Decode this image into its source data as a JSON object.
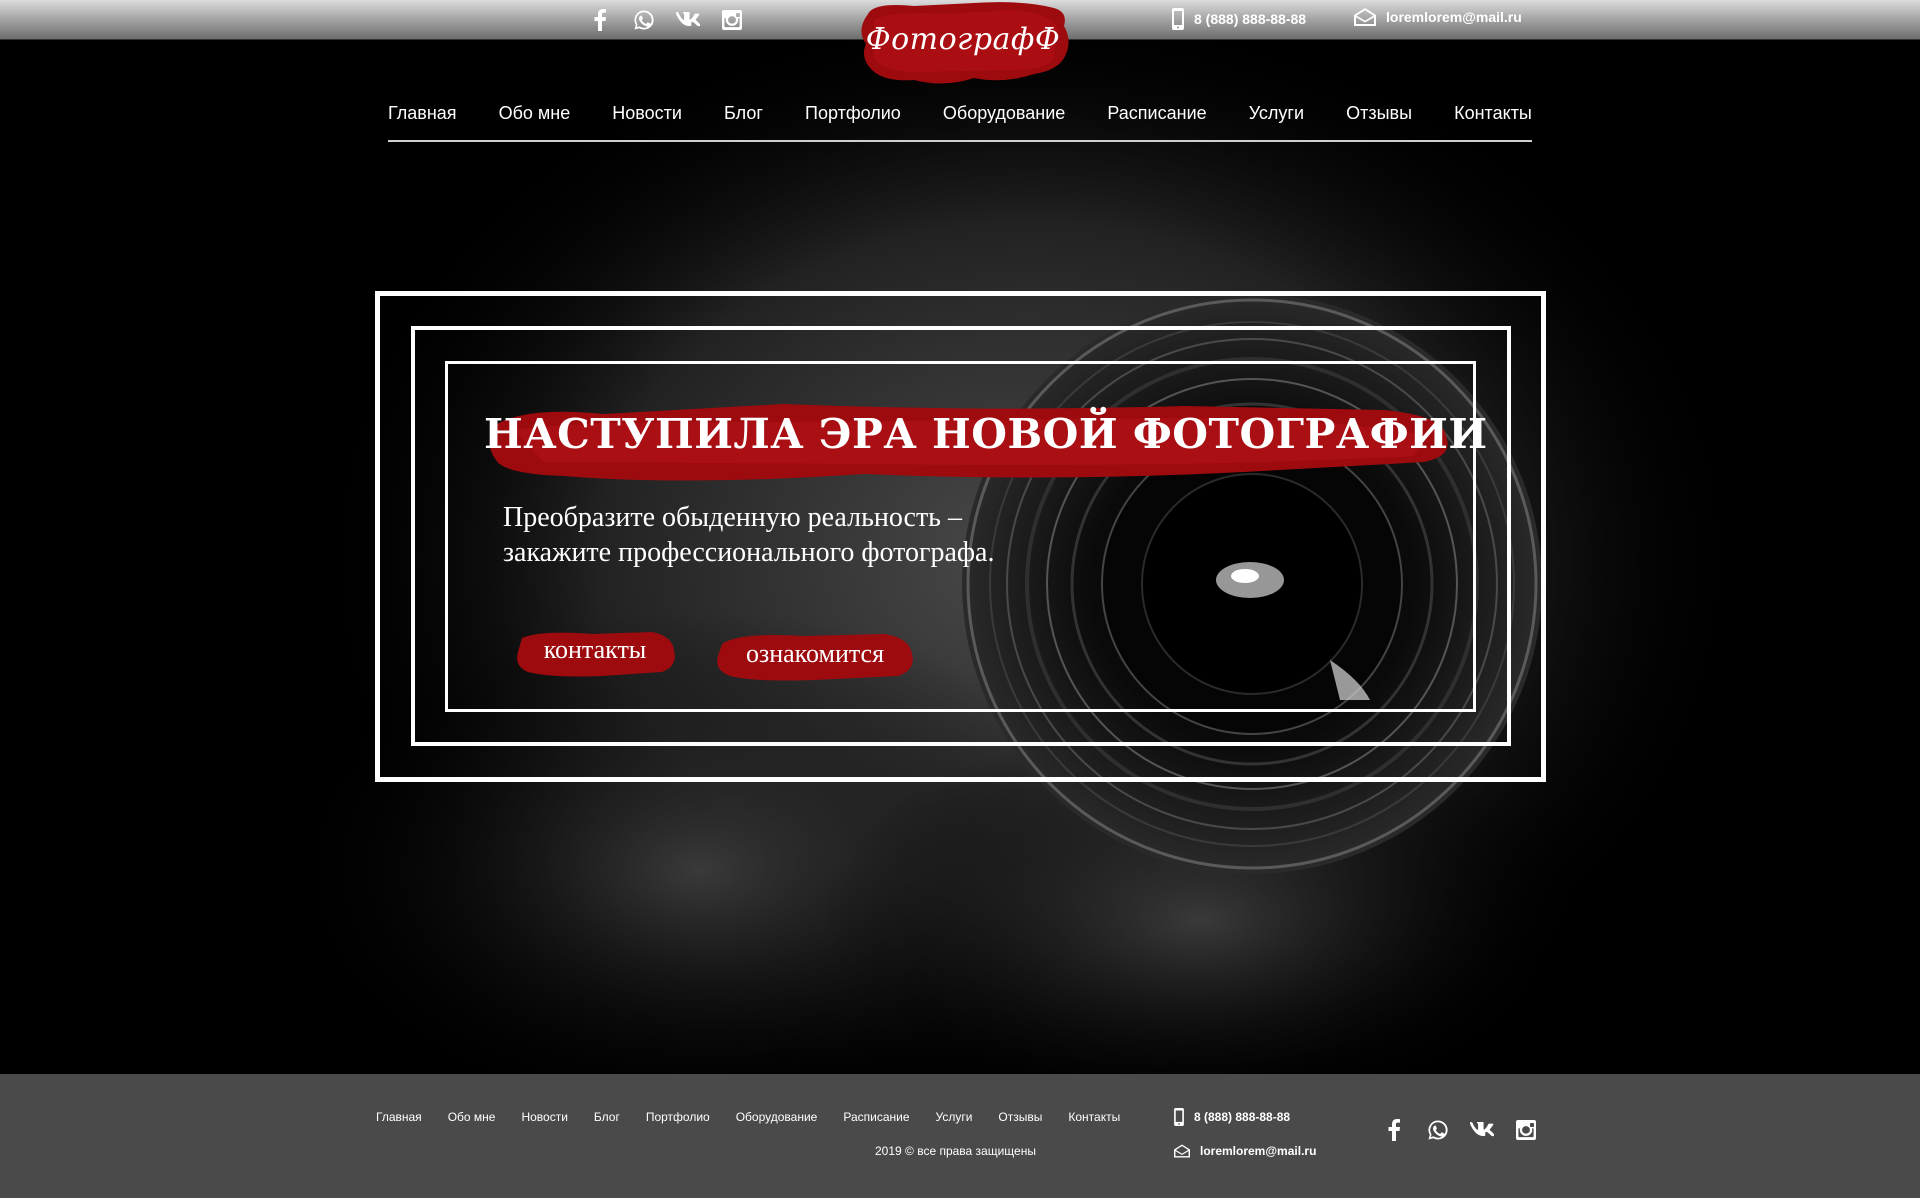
{
  "header": {
    "social": [
      "facebook-icon",
      "whatsapp-icon",
      "vk-icon",
      "instagram-icon"
    ],
    "logo": "ФотографФ",
    "phone": "8 (888) 888-88-88",
    "email": "loremlorem@mail.ru"
  },
  "nav": {
    "items": [
      "Главная",
      "Обо мне",
      "Новости",
      "Блог",
      "Портфолио",
      "Оборудование",
      "Расписание",
      "Услуги",
      "Отзывы",
      "Контакты"
    ]
  },
  "hero": {
    "title": "НАСТУПИЛА ЭРА НОВОЙ ФОТОГРАФИИ",
    "subtitle": "Преобразите обыденную реальность – закажите профессионального фотографа.",
    "button_contacts": "контакты",
    "button_learn": "ознакомится"
  },
  "footer": {
    "nav_items": [
      "Главная",
      "Обо мне",
      "Новости",
      "Блог",
      "Портфолио",
      "Оборудование",
      "Расписание",
      "Услуги",
      "Отзывы",
      "Контакты"
    ],
    "copyright": "2019 © все права защищены",
    "phone": "8 (888) 888-88-88",
    "email": "loremlorem@mail.ru",
    "social": [
      "facebook-icon",
      "whatsapp-icon",
      "vk-icon",
      "instagram-icon"
    ]
  },
  "colors": {
    "accent_red": "#9e0b0f",
    "footer_bg": "#4a4a4a",
    "topbar_gradient": [
      "#dcdcdc",
      "#6d6d6d"
    ]
  }
}
